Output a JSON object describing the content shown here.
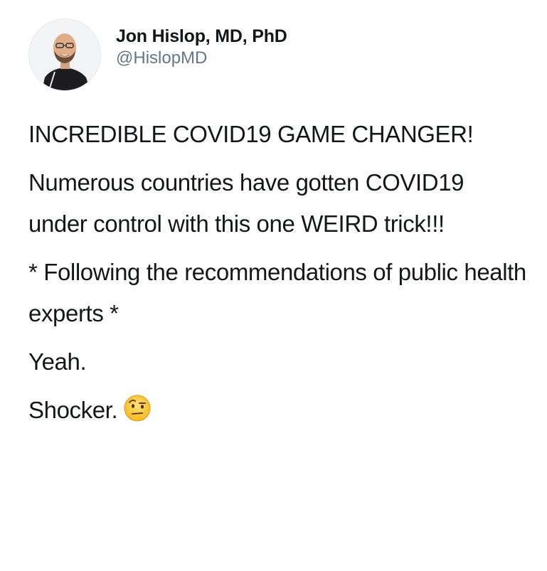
{
  "author": {
    "display_name": "Jon Hislop, MD, PhD",
    "handle": "@HislopMD",
    "avatar_icon": "profile-photo-avatar"
  },
  "tweet": {
    "headline": "INCREDIBLE COVID19 GAME CHANGER!",
    "paragraph_1": "Numerous countries have gotten COVID19 under control with this one WEIRD trick!!!",
    "paragraph_2": "* Following the recommendations of public health experts *",
    "paragraph_3": "Yeah.",
    "paragraph_4": "Shocker.",
    "emoji_icon": "face-with-raised-eyebrow-emoji"
  }
}
